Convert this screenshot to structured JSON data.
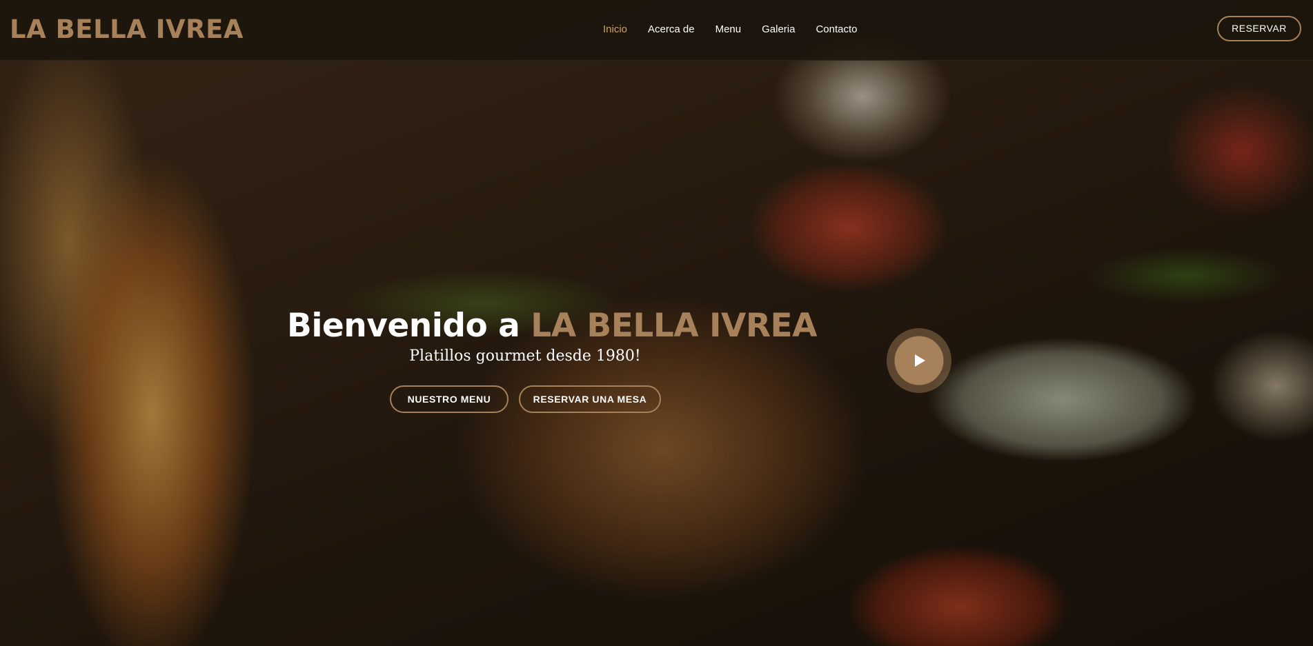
{
  "header": {
    "logo": "LA BELLA IVREA",
    "nav": [
      {
        "label": "Inicio",
        "active": true
      },
      {
        "label": "Acerca de",
        "active": false
      },
      {
        "label": "Menu",
        "active": false
      },
      {
        "label": "Galeria",
        "active": false
      },
      {
        "label": "Contacto",
        "active": false
      }
    ],
    "reserve_button": "RESERVAR"
  },
  "hero": {
    "title_prefix": "Bienvenido a",
    "title_brand": "LA BELLA IVREA",
    "subtitle": "Platillos gourmet desde 1980!",
    "buttons": {
      "menu": "NUESTRO MENU",
      "table": "RESERVAR UNA MESA"
    },
    "play_icon": "play-icon"
  },
  "colors": {
    "accent": "#a7815a",
    "nav_active": "#cda45e",
    "header_bg": "#1a140c",
    "text": "#ffffff"
  }
}
